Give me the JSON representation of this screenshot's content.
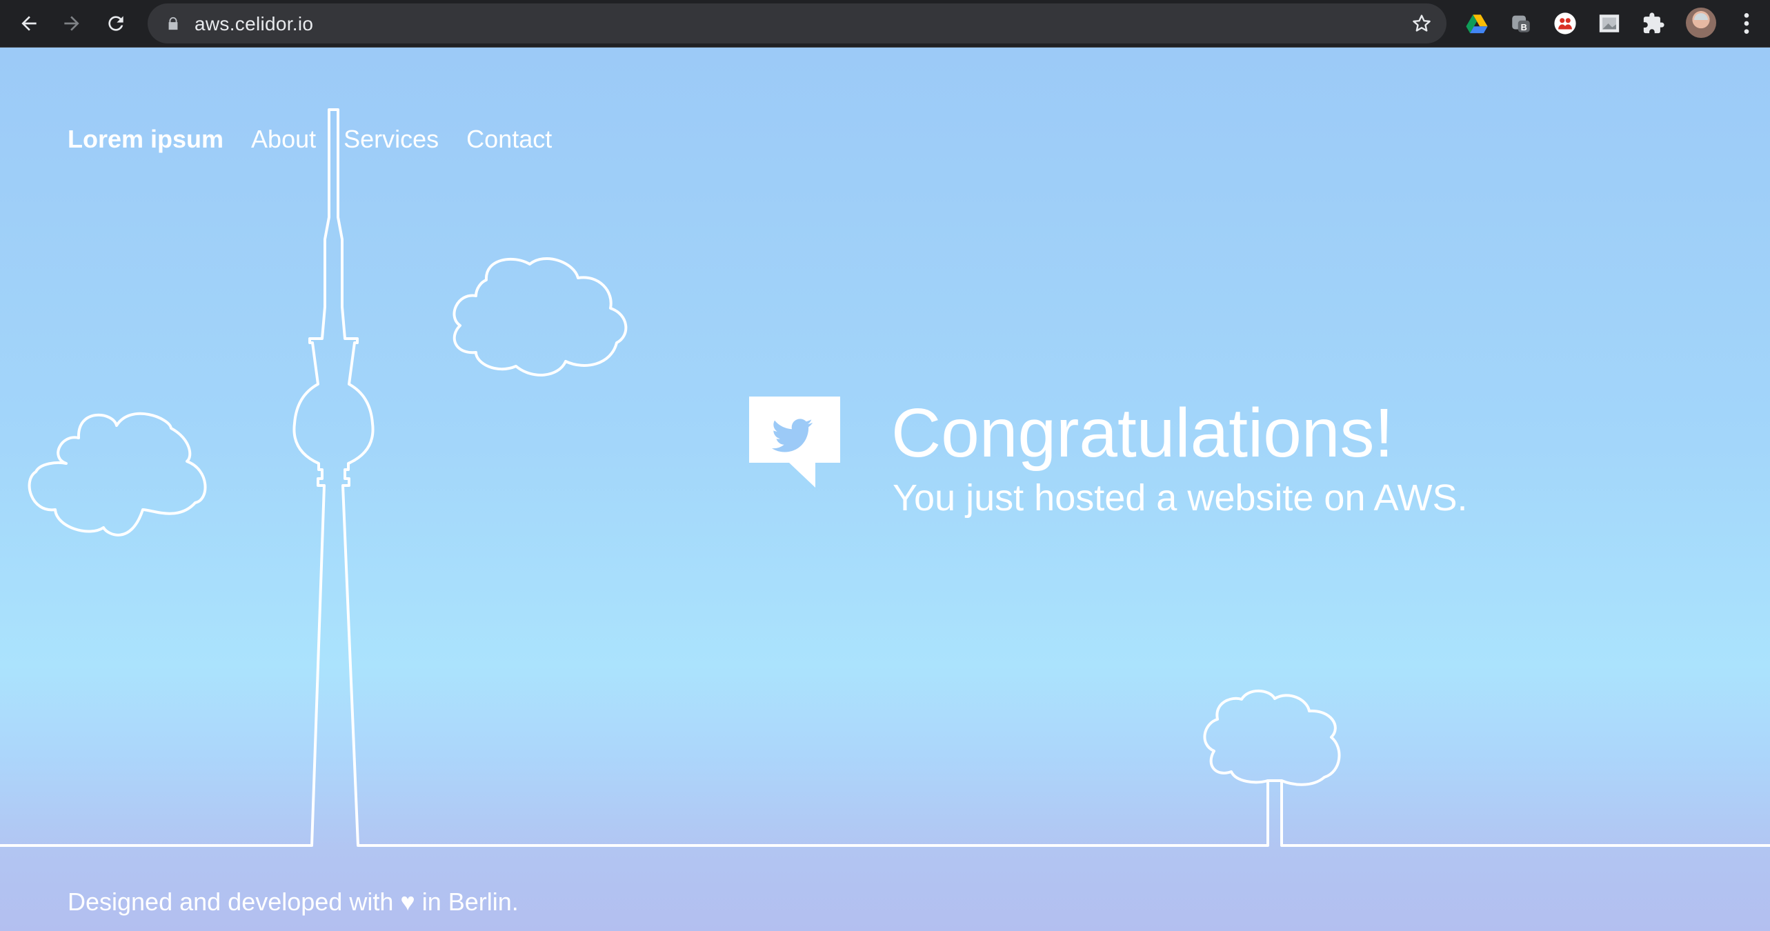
{
  "browser": {
    "url": "aws.celidor.io",
    "icons": {
      "back": "back-arrow-icon",
      "forward": "forward-arrow-icon",
      "reload": "reload-icon",
      "lock": "lock-icon",
      "bookmark": "star-icon",
      "extensions": [
        "google-drive-icon",
        "extension-b-icon",
        "extension-people-icon",
        "extension-screenshot-icon",
        "puzzle-icon"
      ],
      "profile": "avatar",
      "menu": "more-vert-icon"
    }
  },
  "nav": {
    "brand": "Lorem ipsum",
    "links": [
      "About",
      "Services",
      "Contact"
    ]
  },
  "hero": {
    "icon": "twitter-speech-bubble-icon",
    "title": "Congratulations!",
    "subtitle": "You just hosted a website on AWS."
  },
  "footer": {
    "text": "Designed and developed with ♥ in Berlin."
  },
  "colors": {
    "sky_top": "#9ccaf7",
    "sky_mid": "#abe3fd",
    "sky_bottom": "#b3bff0",
    "line": "#ffffff",
    "toolbar": "#202124",
    "omnibox": "#35363a"
  }
}
